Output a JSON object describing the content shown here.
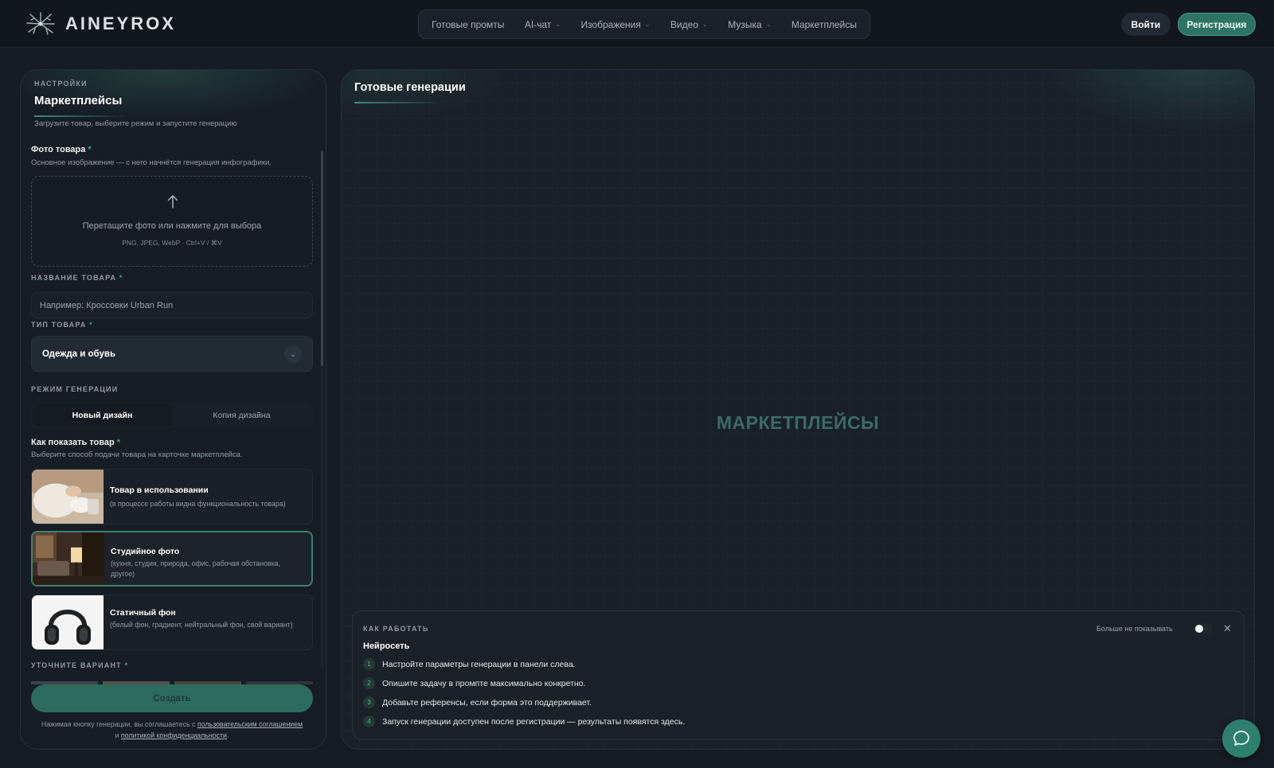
{
  "header": {
    "logo_text": "AINEYROX",
    "nav": [
      {
        "label": "Готовые промты",
        "has_dropdown": false
      },
      {
        "label": "AI-чат",
        "has_dropdown": true
      },
      {
        "label": "Изображения",
        "has_dropdown": true
      },
      {
        "label": "Видео",
        "has_dropdown": true
      },
      {
        "label": "Музыка",
        "has_dropdown": true
      },
      {
        "label": "Маркетплейсы",
        "has_dropdown": false
      }
    ],
    "login_label": "Войти",
    "register_label": "Регистрация"
  },
  "settings": {
    "kicker": "НАСТРОЙКИ",
    "title": "Маркетплейсы",
    "subtitle": "Загрузите товар, выберите режим и запустите генерацию",
    "photo": {
      "label": "Фото товара",
      "required_mark": "*",
      "hint": "Основное изображение — с него начнётся генерация инфографики.",
      "dropzone_text": "Перетащите фото или нажмите для выбора",
      "dropzone_formats": "PNG, JPEG, WebP · Ctrl+V / ⌘V"
    },
    "name": {
      "label": "НАЗВАНИЕ ТОВАРА",
      "required_mark": "*",
      "placeholder": "Например: Кроссовки Urban Run"
    },
    "type": {
      "label": "ТИП ТОВАРА",
      "required_mark": "*",
      "value": "Одежда и обувь"
    },
    "mode": {
      "label": "РЕЖИМ ГЕНЕРАЦИИ",
      "options": [
        "Новый дизайн",
        "Копия дизайна"
      ],
      "active_index": 0
    },
    "presentation": {
      "label": "Как показать товар",
      "required_mark": "*",
      "hint": "Выберите способ подачи товара на карточке маркетплейса.",
      "cards": [
        {
          "title": "Товар в использовании",
          "desc": "(в процессе работы видна функциональность товара)",
          "selected": false
        },
        {
          "title": "Студийное фото",
          "desc": "(кухня, студия, природа, офис, рабочая обстановка, другое)",
          "selected": true
        },
        {
          "title": "Статичный фон",
          "desc": "(белый фон, градиент, нейтральный фон, свой вариант)",
          "selected": false
        }
      ]
    },
    "variant": {
      "label": "УТОЧНИТЕ ВАРИАНТ",
      "required_mark": "*"
    },
    "create_label": "Создать",
    "legal": {
      "prefix": "Нажимая кнопку генерации, вы соглашаетесь с ",
      "link1": "пользовательским соглашением",
      "middle": "и ",
      "link2": "политикой конфиденциальности",
      "suffix": "."
    }
  },
  "results": {
    "title": "Готовые генерации",
    "watermark": "МАРКЕТПЛЕЙСЫ",
    "howto": {
      "kicker": "КАК РАБОТАТЬ",
      "title": "Нейросеть",
      "dont_show_label": "Больше не показывать",
      "steps": [
        {
          "num": "1",
          "text": "Настройте параметры генерации в панели слева."
        },
        {
          "num": "2",
          "text": "Опишите задачу в промпте максимально конкретно."
        },
        {
          "num": "3",
          "text": "Добавьте референсы, если форма это поддерживает."
        },
        {
          "num": "4",
          "text": "Запуск генерации доступен после регистрации — результаты появятся здесь."
        }
      ]
    }
  },
  "colors": {
    "accent": "#2e7466",
    "background": "#161c24",
    "panel": "#1a2029"
  }
}
